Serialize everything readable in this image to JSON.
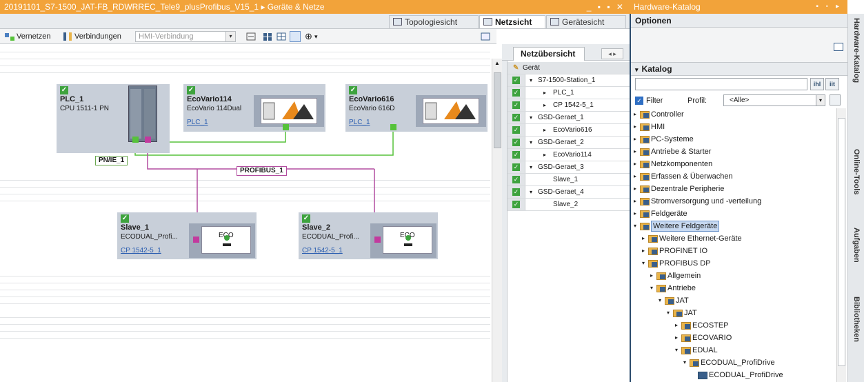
{
  "window": {
    "title": "20191101_S7-1500_JAT-FB_RDWRREC_Tele9_plusProfibus_V15_1 ▸ Geräte & Netze",
    "controls": "_ ▪ ▪ ✕"
  },
  "view_tabs": {
    "topology": "Topologiesicht",
    "network": "Netzsicht",
    "device": "Gerätesicht"
  },
  "toolbar": {
    "network_label": "Vernetzen",
    "connections_label": "Verbindungen",
    "hmi_select": "HMI-Verbindung"
  },
  "devices": {
    "plc": {
      "name": "PLC_1",
      "type": "CPU 1511-1 PN"
    },
    "ev114": {
      "name": "EcoVario114",
      "type": "EcoVario 114Dual",
      "link": "PLC_1"
    },
    "ev616": {
      "name": "EcoVario616",
      "type": "EcoVario 616D",
      "link": "PLC_1"
    },
    "slave1": {
      "name": "Slave_1",
      "type": "ECODUAL_Profi...",
      "link": "CP 1542-5_1"
    },
    "slave2": {
      "name": "Slave_2",
      "type": "ECODUAL_Profi...",
      "link": "CP 1542-5_1"
    }
  },
  "networks": {
    "pnie": "PN/IE_1",
    "profibus": "PROFIBUS_1"
  },
  "overview": {
    "tab": "Netzübersicht",
    "nav": "◂ ▸",
    "header": "Gerät",
    "rows": [
      {
        "label": "S7-1500-Station_1",
        "arrow": "▾",
        "indent": 0
      },
      {
        "label": "PLC_1",
        "arrow": "▸",
        "indent": 1
      },
      {
        "label": "CP 1542-5_1",
        "arrow": "▸",
        "indent": 1
      },
      {
        "label": "GSD-Geraet_1",
        "arrow": "▾",
        "indent": 0
      },
      {
        "label": "EcoVario616",
        "arrow": "▸",
        "indent": 1
      },
      {
        "label": "GSD-Geraet_2",
        "arrow": "▾",
        "indent": 0
      },
      {
        "label": "EcoVario114",
        "arrow": "▸",
        "indent": 1
      },
      {
        "label": "GSD-Geraet_3",
        "arrow": "▾",
        "indent": 0
      },
      {
        "label": "Slave_1",
        "arrow": "",
        "indent": 1
      },
      {
        "label": "GSD-Geraet_4",
        "arrow": "▾",
        "indent": 0
      },
      {
        "label": "Slave_2",
        "arrow": "",
        "indent": 1
      }
    ]
  },
  "catalog": {
    "title": "Hardware-Katalog",
    "options": "Optionen",
    "section": "Katalog",
    "filter_label": "Filter",
    "profile_label": "Profil:",
    "profile_value": "<Alle>",
    "tree": [
      {
        "label": "Controller",
        "depth": 0,
        "arrow": "▸"
      },
      {
        "label": "HMI",
        "depth": 0,
        "arrow": "▸"
      },
      {
        "label": "PC-Systeme",
        "depth": 0,
        "arrow": "▸"
      },
      {
        "label": "Antriebe & Starter",
        "depth": 0,
        "arrow": "▸"
      },
      {
        "label": "Netzkomponenten",
        "depth": 0,
        "arrow": "▸"
      },
      {
        "label": "Erfassen & Überwachen",
        "depth": 0,
        "arrow": "▸"
      },
      {
        "label": "Dezentrale Peripherie",
        "depth": 0,
        "arrow": "▸"
      },
      {
        "label": "Stromversorgung und -verteilung",
        "depth": 0,
        "arrow": "▸"
      },
      {
        "label": "Feldgeräte",
        "depth": 0,
        "arrow": "▸"
      },
      {
        "label": "Weitere Feldgeräte",
        "depth": 0,
        "arrow": "▾",
        "selected": true
      },
      {
        "label": "Weitere Ethernet-Geräte",
        "depth": 1,
        "arrow": "▸"
      },
      {
        "label": "PROFINET IO",
        "depth": 1,
        "arrow": "▸"
      },
      {
        "label": "PROFIBUS DP",
        "depth": 1,
        "arrow": "▾"
      },
      {
        "label": "Allgemein",
        "depth": 2,
        "arrow": "▸"
      },
      {
        "label": "Antriebe",
        "depth": 2,
        "arrow": "▾"
      },
      {
        "label": "JAT",
        "depth": 3,
        "arrow": "▾"
      },
      {
        "label": "JAT",
        "depth": 4,
        "arrow": "▾"
      },
      {
        "label": "ECOSTEP",
        "depth": 5,
        "arrow": "▸"
      },
      {
        "label": "ECOVARIO",
        "depth": 5,
        "arrow": "▸"
      },
      {
        "label": "EDUAL",
        "depth": 5,
        "arrow": "▾"
      },
      {
        "label": "ECODUAL_ProfiDrive",
        "depth": 6,
        "arrow": "▾"
      },
      {
        "label": "ECODUAL_ProfiDrive",
        "depth": 7,
        "arrow": ""
      }
    ]
  },
  "side_tabs": {
    "hw": "Hardware-Katalog",
    "online": "Online-Tools",
    "tasks": "Aufgaben",
    "libs": "Bibliotheken"
  },
  "colors": {
    "title_bar": "#f2a33a",
    "pn_line": "#56c23a",
    "profibus_line": "#b34da0",
    "check": "#3ea33e"
  }
}
